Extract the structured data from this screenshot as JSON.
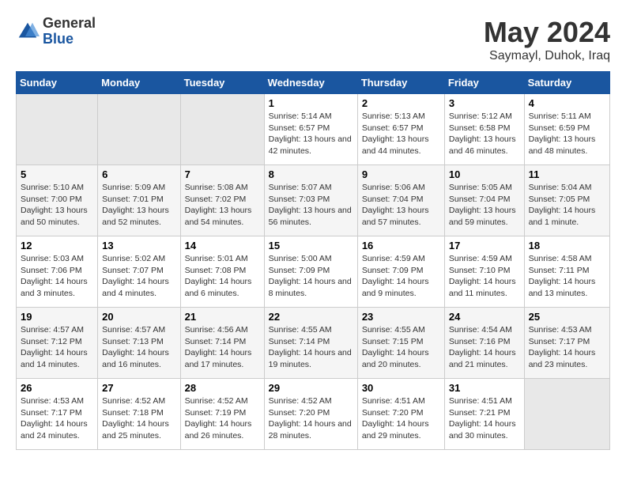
{
  "header": {
    "logo_general": "General",
    "logo_blue": "Blue",
    "month": "May 2024",
    "location": "Saymayl, Duhok, Iraq"
  },
  "days_of_week": [
    "Sunday",
    "Monday",
    "Tuesday",
    "Wednesday",
    "Thursday",
    "Friday",
    "Saturday"
  ],
  "weeks": [
    [
      {
        "day": "",
        "empty": true
      },
      {
        "day": "",
        "empty": true
      },
      {
        "day": "",
        "empty": true
      },
      {
        "day": "1",
        "sunrise": "5:14 AM",
        "sunset": "6:57 PM",
        "daylight": "13 hours and 42 minutes."
      },
      {
        "day": "2",
        "sunrise": "5:13 AM",
        "sunset": "6:57 PM",
        "daylight": "13 hours and 44 minutes."
      },
      {
        "day": "3",
        "sunrise": "5:12 AM",
        "sunset": "6:58 PM",
        "daylight": "13 hours and 46 minutes."
      },
      {
        "day": "4",
        "sunrise": "5:11 AM",
        "sunset": "6:59 PM",
        "daylight": "13 hours and 48 minutes."
      }
    ],
    [
      {
        "day": "5",
        "sunrise": "5:10 AM",
        "sunset": "7:00 PM",
        "daylight": "13 hours and 50 minutes."
      },
      {
        "day": "6",
        "sunrise": "5:09 AM",
        "sunset": "7:01 PM",
        "daylight": "13 hours and 52 minutes."
      },
      {
        "day": "7",
        "sunrise": "5:08 AM",
        "sunset": "7:02 PM",
        "daylight": "13 hours and 54 minutes."
      },
      {
        "day": "8",
        "sunrise": "5:07 AM",
        "sunset": "7:03 PM",
        "daylight": "13 hours and 56 minutes."
      },
      {
        "day": "9",
        "sunrise": "5:06 AM",
        "sunset": "7:04 PM",
        "daylight": "13 hours and 57 minutes."
      },
      {
        "day": "10",
        "sunrise": "5:05 AM",
        "sunset": "7:04 PM",
        "daylight": "13 hours and 59 minutes."
      },
      {
        "day": "11",
        "sunrise": "5:04 AM",
        "sunset": "7:05 PM",
        "daylight": "14 hours and 1 minute."
      }
    ],
    [
      {
        "day": "12",
        "sunrise": "5:03 AM",
        "sunset": "7:06 PM",
        "daylight": "14 hours and 3 minutes."
      },
      {
        "day": "13",
        "sunrise": "5:02 AM",
        "sunset": "7:07 PM",
        "daylight": "14 hours and 4 minutes."
      },
      {
        "day": "14",
        "sunrise": "5:01 AM",
        "sunset": "7:08 PM",
        "daylight": "14 hours and 6 minutes."
      },
      {
        "day": "15",
        "sunrise": "5:00 AM",
        "sunset": "7:09 PM",
        "daylight": "14 hours and 8 minutes."
      },
      {
        "day": "16",
        "sunrise": "4:59 AM",
        "sunset": "7:09 PM",
        "daylight": "14 hours and 9 minutes."
      },
      {
        "day": "17",
        "sunrise": "4:59 AM",
        "sunset": "7:10 PM",
        "daylight": "14 hours and 11 minutes."
      },
      {
        "day": "18",
        "sunrise": "4:58 AM",
        "sunset": "7:11 PM",
        "daylight": "14 hours and 13 minutes."
      }
    ],
    [
      {
        "day": "19",
        "sunrise": "4:57 AM",
        "sunset": "7:12 PM",
        "daylight": "14 hours and 14 minutes."
      },
      {
        "day": "20",
        "sunrise": "4:57 AM",
        "sunset": "7:13 PM",
        "daylight": "14 hours and 16 minutes."
      },
      {
        "day": "21",
        "sunrise": "4:56 AM",
        "sunset": "7:14 PM",
        "daylight": "14 hours and 17 minutes."
      },
      {
        "day": "22",
        "sunrise": "4:55 AM",
        "sunset": "7:14 PM",
        "daylight": "14 hours and 19 minutes."
      },
      {
        "day": "23",
        "sunrise": "4:55 AM",
        "sunset": "7:15 PM",
        "daylight": "14 hours and 20 minutes."
      },
      {
        "day": "24",
        "sunrise": "4:54 AM",
        "sunset": "7:16 PM",
        "daylight": "14 hours and 21 minutes."
      },
      {
        "day": "25",
        "sunrise": "4:53 AM",
        "sunset": "7:17 PM",
        "daylight": "14 hours and 23 minutes."
      }
    ],
    [
      {
        "day": "26",
        "sunrise": "4:53 AM",
        "sunset": "7:17 PM",
        "daylight": "14 hours and 24 minutes."
      },
      {
        "day": "27",
        "sunrise": "4:52 AM",
        "sunset": "7:18 PM",
        "daylight": "14 hours and 25 minutes."
      },
      {
        "day": "28",
        "sunrise": "4:52 AM",
        "sunset": "7:19 PM",
        "daylight": "14 hours and 26 minutes."
      },
      {
        "day": "29",
        "sunrise": "4:52 AM",
        "sunset": "7:20 PM",
        "daylight": "14 hours and 28 minutes."
      },
      {
        "day": "30",
        "sunrise": "4:51 AM",
        "sunset": "7:20 PM",
        "daylight": "14 hours and 29 minutes."
      },
      {
        "day": "31",
        "sunrise": "4:51 AM",
        "sunset": "7:21 PM",
        "daylight": "14 hours and 30 minutes."
      },
      {
        "day": "",
        "empty": true
      }
    ]
  ]
}
